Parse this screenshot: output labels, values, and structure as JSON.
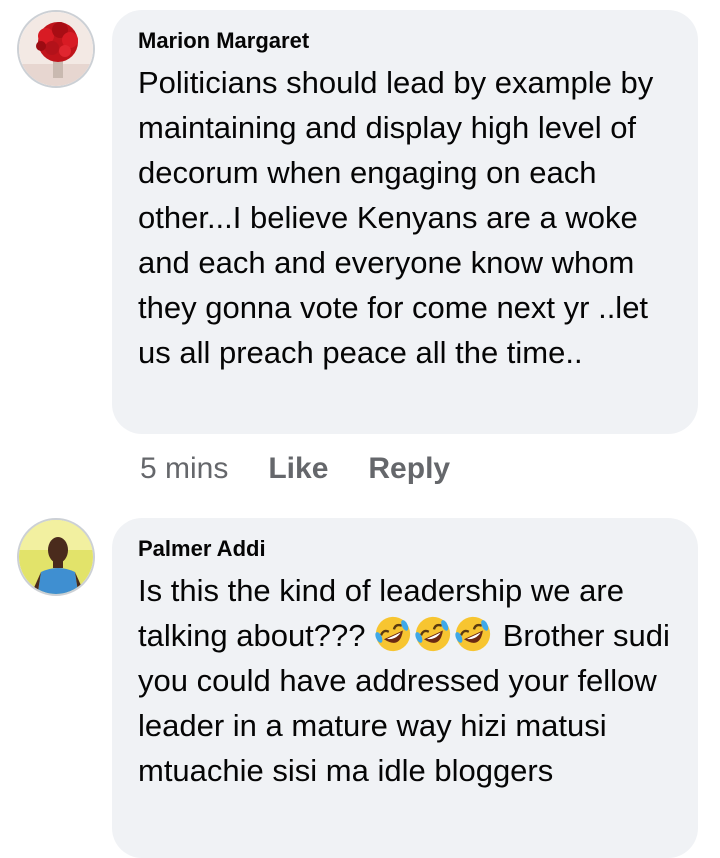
{
  "comments": [
    {
      "author": "Marion Margaret",
      "avatar_icon": "red-roses-avatar",
      "text": "Politicians should lead by example by maintaining and display high level of decorum when engaging on each other...I believe Kenyans are a woke and each and everyone know whom they gonna vote  for come next yr ..let us  all preach peace all the time..",
      "time": "5 mins",
      "like_label": "Like",
      "reply_label": "Reply"
    },
    {
      "author": "Palmer Addi",
      "avatar_icon": "man-blue-shirt-avatar",
      "text_before": "Is this the kind of leadership we are talking about??? ",
      "emoji_icon": "rolling-on-floor-laughing-emoji",
      "text_after": " Brother sudi you could have addressed your fellow leader in a mature way hizi matusi mtuachie sisi ma idle bloggers"
    }
  ],
  "colors": {
    "bubble": "#f0f2f5",
    "meta_text": "#65676b",
    "body_text": "#050505"
  }
}
